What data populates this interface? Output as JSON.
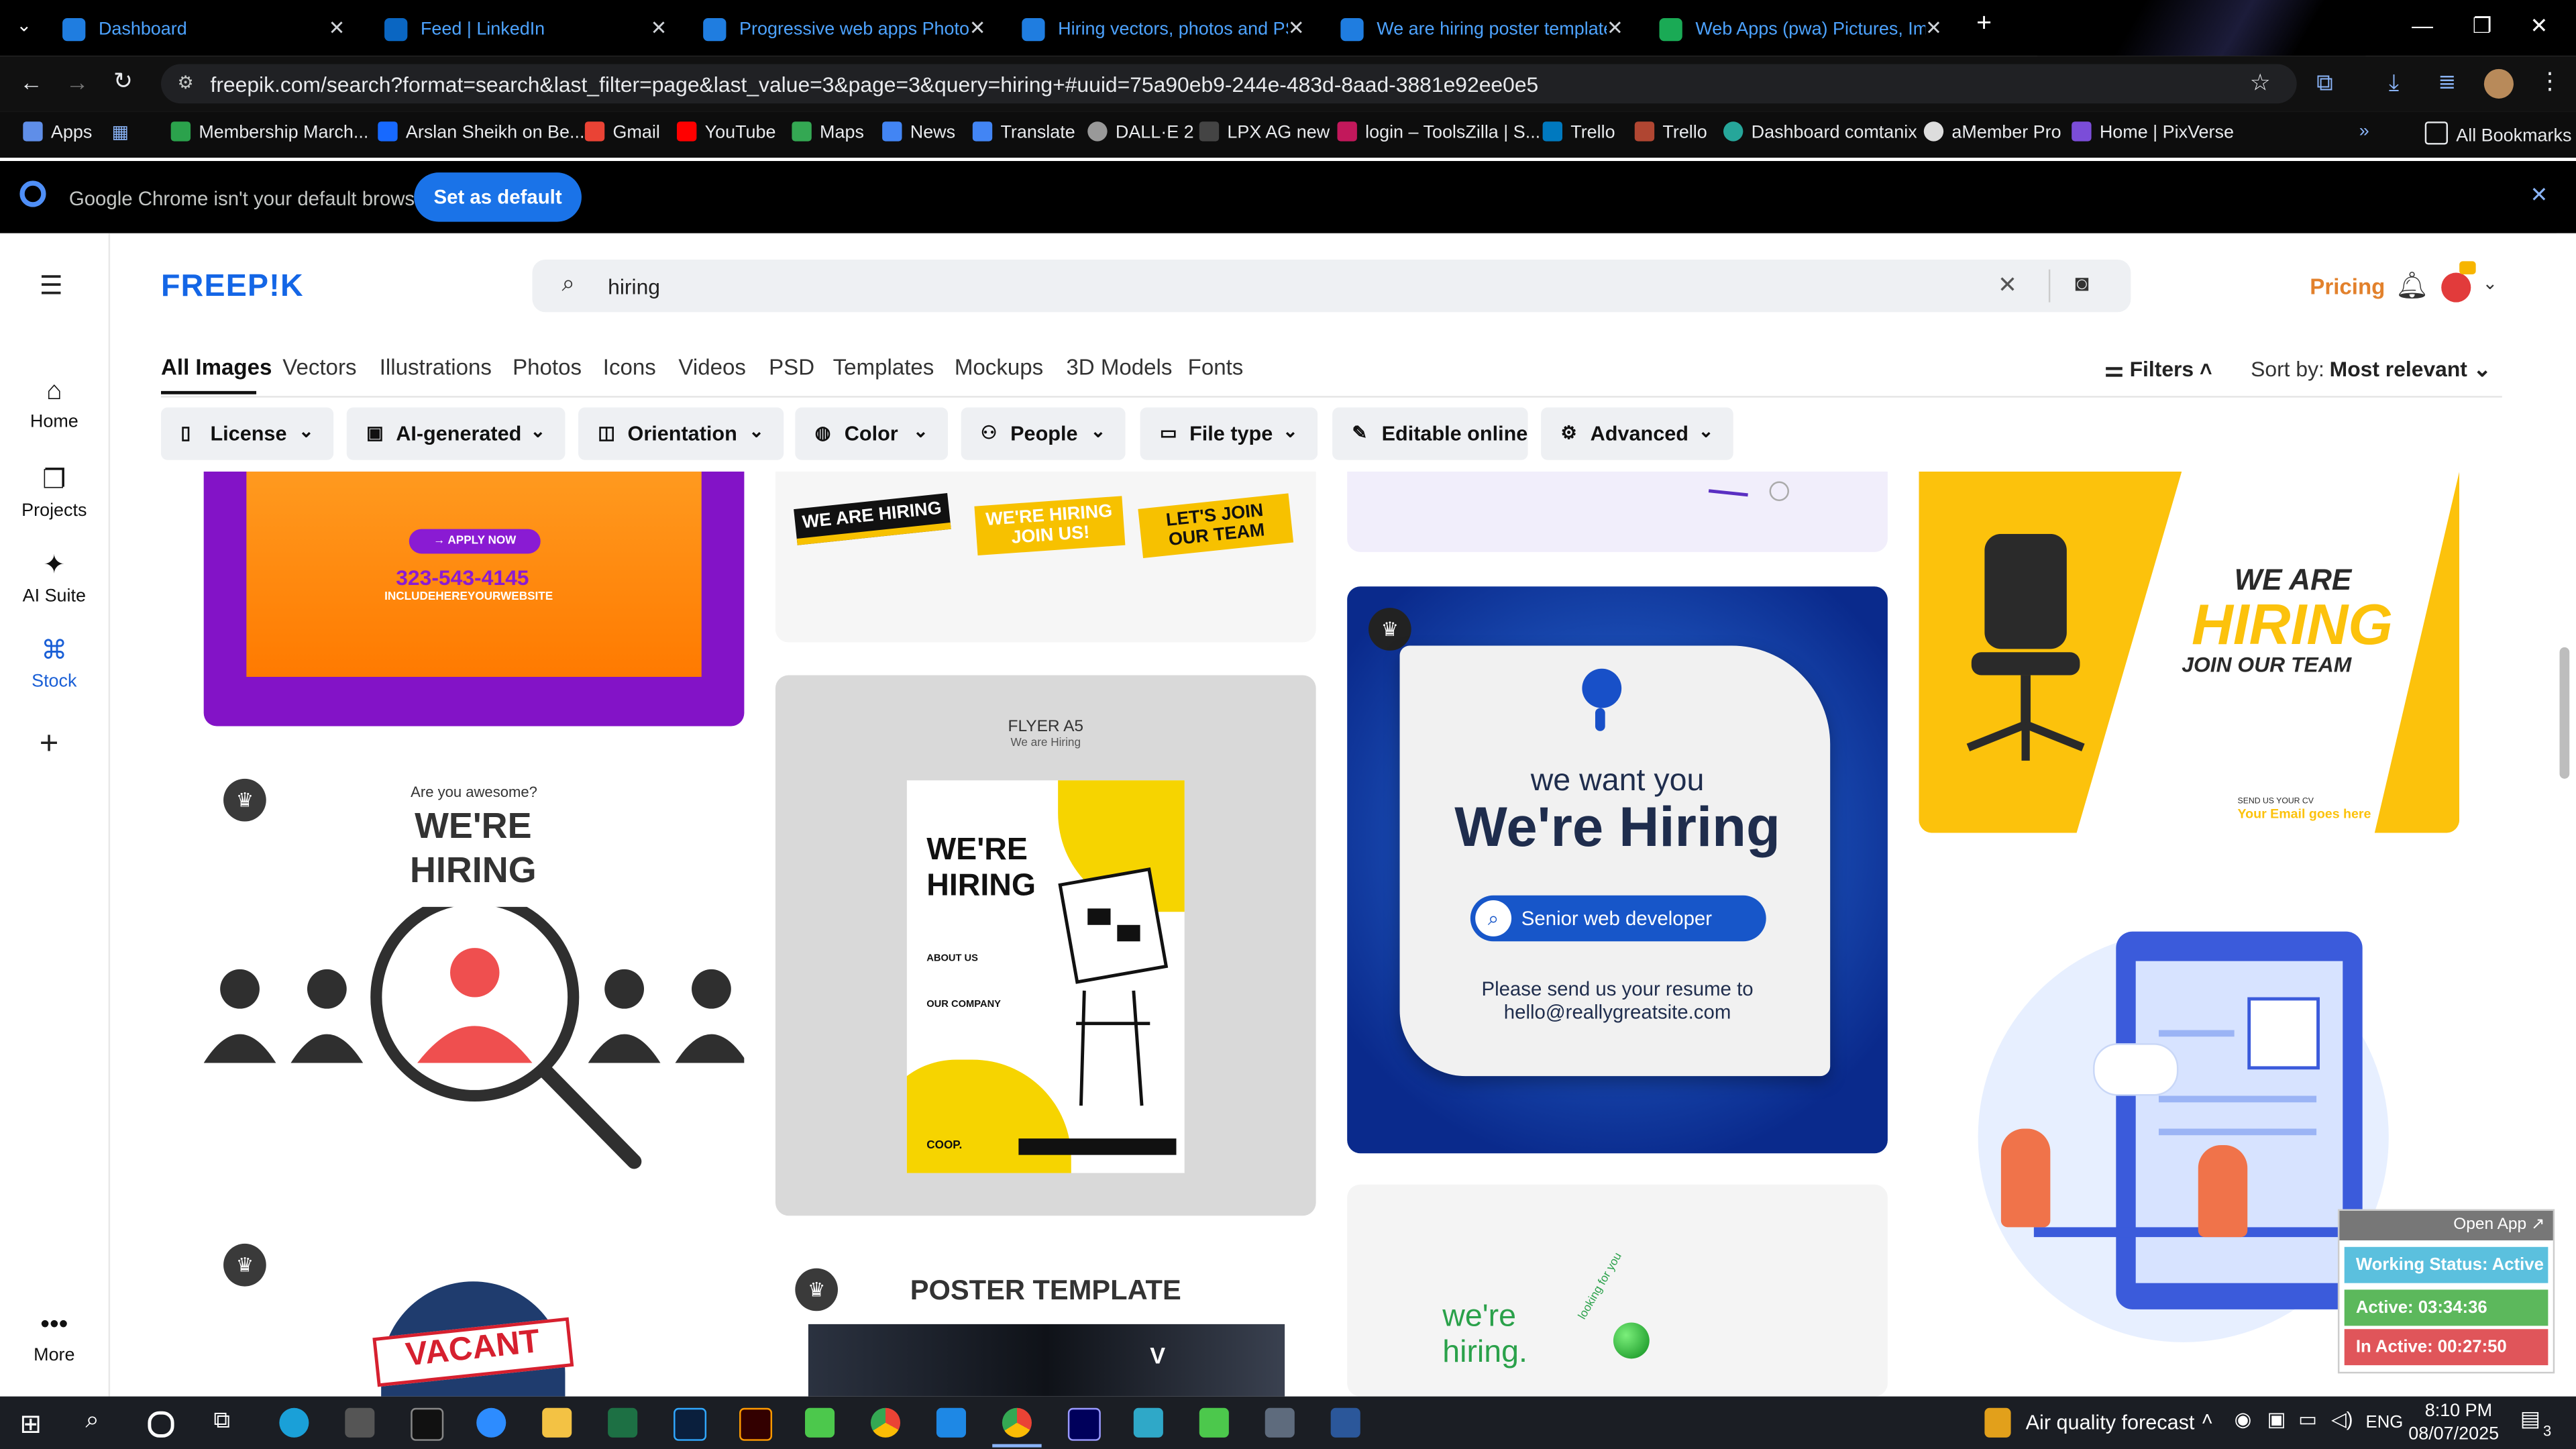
{
  "browser": {
    "tabs": [
      {
        "label": "Dashboard",
        "color": "#1f7de0"
      },
      {
        "label": "Feed | LinkedIn",
        "color": "#0a66c2"
      },
      {
        "label": "Progressive web apps Photos |",
        "color": "#1f7de0"
      },
      {
        "label": "Hiring vectors, photos and PSD",
        "color": "#1f7de0"
      },
      {
        "label": "We are hiring poster template |",
        "color": "#1f7de0"
      },
      {
        "label": "Web Apps (pwa) Pictures, Imag",
        "color": "#1aaa55"
      }
    ],
    "url": "freepik.com/search?format=search&last_filter=page&last_value=3&page=3&query=hiring+#uuid=75a90eb9-244e-483d-8aad-3881e92ee0e5",
    "bookmarks": [
      "Apps",
      "Membership March...",
      "Arslan Sheikh on Be...",
      "Gmail",
      "YouTube",
      "Maps",
      "News",
      "Translate",
      "DALL·E 2",
      "LPX AG new",
      "login – ToolsZilla | S...",
      "Trello",
      "Trello",
      "Dashboard comtanix",
      "aMember Pro",
      "Home | PixVerse"
    ],
    "all_bookmarks": "All Bookmarks",
    "infobar_text": "Google Chrome isn't your default browser",
    "set_default": "Set as default"
  },
  "header": {
    "logo": "FREEP!K",
    "search_value": "hiring",
    "pricing": "Pricing"
  },
  "leftnav": {
    "items": [
      "Home",
      "Projects",
      "AI Suite",
      "Stock"
    ],
    "more": "More"
  },
  "categories": [
    "All Images",
    "Vectors",
    "Illustrations",
    "Photos",
    "Icons",
    "Videos",
    "PSD",
    "Templates",
    "Mockups",
    "3D Models",
    "Fonts"
  ],
  "filters_label": "Filters",
  "sort_label": "Sort by:",
  "sort_value": "Most relevant",
  "chips": [
    "License",
    "AI-generated",
    "Orientation",
    "Color",
    "People",
    "File type",
    "Editable online",
    "Advanced"
  ],
  "cards": {
    "apply_now": "APPLY NOW",
    "phone": "323-543-4145",
    "website": "INCLUDEHEREYOURWEBSITE",
    "awesome": "Are you awesome?",
    "were_hiring_caps": "WE'RE HIRING",
    "vacant": "VACANT",
    "stickers": [
      "WE ARE HIRING",
      "WE'RE HIRING JOIN US!",
      "LET'S JOIN OUR TEAM"
    ],
    "flyer_title": "FLYER A5",
    "flyer_sub": "We are Hiring",
    "flyer_head": "WE'RE HIRING",
    "flyer_about": "ABOUT US",
    "flyer_company": "OUR COMPANY",
    "flyer_brand": "COOP.",
    "poster_template": "POSTER TEMPLATE",
    "we_want_you": "we want you",
    "were_hiring_mixed": "We're Hiring",
    "senior_dev": "Senior web developer",
    "send_resume": "Please send us your resume to",
    "email": "hello@reallygreatsite.com",
    "were_hiring_green": "we're hiring.",
    "looking_for_you": "looking for you",
    "we_are": "WE ARE",
    "hiring": "HIRING",
    "join_team": "JOIN OUR TEAM",
    "send_cv": "SEND US YOUR CV",
    "email_here": "Your Email goes here"
  },
  "widget": {
    "open_app": "Open App ↗",
    "working_status": "Working Status: Active",
    "active": "Active: 03:34:36",
    "inactive": "In Active: 00:27:50"
  },
  "taskbar": {
    "air_quality": "Air quality forecast",
    "lang": "ENG",
    "time": "8:10 PM",
    "date": "08/07/2025",
    "notif_count": "3"
  }
}
